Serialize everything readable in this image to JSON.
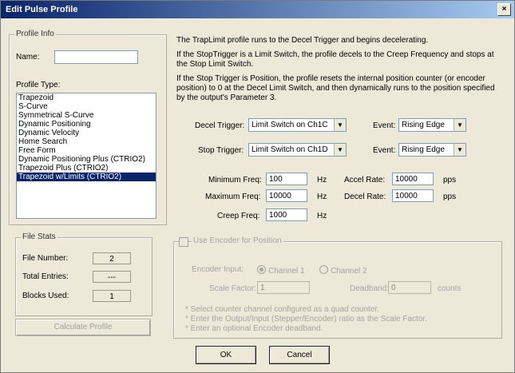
{
  "window": {
    "title": "Edit Pulse Profile",
    "close_glyph": "×"
  },
  "profile_info": {
    "legend": "Profile Info",
    "name_label": "Name:",
    "name_value": "",
    "type_label": "Profile Type:",
    "types": [
      "Trapezoid",
      "S-Curve",
      "Symmetrical S-Curve",
      "Dynamic Positioning",
      "Dynamic Velocity",
      "Home Search",
      "Free Form",
      "Dynamic Positioning Plus (CTRIO2)",
      "Trapezoid Plus (CTRIO2)",
      "Trapezoid w/Limits (CTRIO2)"
    ],
    "selected_index": 9
  },
  "file_stats": {
    "legend": "File Stats",
    "file_number_label": "File Number:",
    "file_number": "2",
    "total_entries_label": "Total Entries:",
    "total_entries": "---",
    "blocks_used_label": "Blocks Used:",
    "blocks_used": "1"
  },
  "calculate_button": "Calculate Profile",
  "description": {
    "line1": "The TrapLimit profile runs to the Decel Trigger and begins decelerating.",
    "line2": "If the StopTrigger is a Limit Switch, the profile decels to the Creep Frequency and stops at the Stop Limit Switch.",
    "line3": "If the Stop Trigger is Position, the profile resets the internal position counter  (or encoder position) to 0 at the Decel Limit Switch, and then dynamically runs to the position specified by the output's Parameter 3."
  },
  "triggers": {
    "decel_label": "Decel Trigger:",
    "decel_value": "Limit Switch on Ch1C",
    "decel_event_label": "Event:",
    "decel_event_value": "Rising Edge",
    "stop_label": "Stop Trigger:",
    "stop_value": "Limit Switch on Ch1D",
    "stop_event_label": "Event:",
    "stop_event_value": "Rising Edge"
  },
  "params": {
    "min_freq_label": "Minimum Freq:",
    "min_freq": "100",
    "max_freq_label": "Maximum Freq:",
    "max_freq": "10000",
    "creep_freq_label": "Creep Freq:",
    "creep_freq": "1000",
    "hz": "Hz",
    "accel_label": "Accel Rate:",
    "accel": "10000",
    "decel_label": "Decel Rate:",
    "decel": "10000",
    "pps": "pps"
  },
  "encoder": {
    "checkbox_label": "Use Encoder for Position",
    "input_label": "Encoder Input:",
    "channel1": "Channel 1",
    "channel2": "Channel 2",
    "scale_label": "Scale Factor:",
    "scale_value": "1",
    "deadband_label": "Deadband:",
    "deadband_value": "0",
    "counts": "counts",
    "note1": "* Select counter channel configured as a quad counter.",
    "note2": "* Enter the Output/Input (Stepper/Encoder) ratio as the Scale Factor.",
    "note3": "* Enter an optional Encoder deadband."
  },
  "buttons": {
    "ok": "OK",
    "cancel": "Cancel"
  }
}
